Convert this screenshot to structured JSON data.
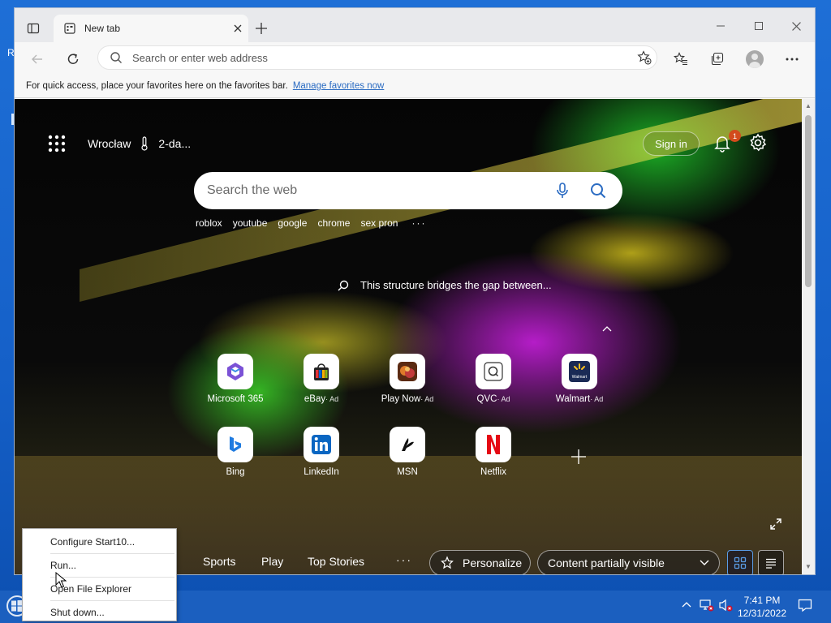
{
  "desktop": {
    "letter": "R"
  },
  "browser": {
    "tab_title": "New tab",
    "address_placeholder": "Search or enter web address",
    "favbar_text": "For quick access, place your favorites here on the favorites bar.",
    "favbar_link": "Manage favorites now"
  },
  "page": {
    "location": "Wrocław",
    "weather_text": "2-da...",
    "sign_in": "Sign in",
    "notification_count": "1",
    "search_placeholder": "Search the web",
    "trending": [
      "roblox",
      "youtube",
      "google",
      "chrome",
      "sex pron"
    ],
    "trending_more": "···",
    "caption": "This structure bridges the gap between...",
    "tiles": [
      {
        "label": "Microsoft 365",
        "ad": "",
        "icon": "microsoft365-icon"
      },
      {
        "label": "eBay",
        "ad": "· Ad",
        "icon": "ebay-icon"
      },
      {
        "label": "Play Now",
        "ad": "· Ad",
        "icon": "playnow-icon"
      },
      {
        "label": "QVC",
        "ad": "· Ad",
        "icon": "qvc-icon"
      },
      {
        "label": "Walmart",
        "ad": "· Ad",
        "icon": "walmart-icon"
      },
      {
        "label": "Bing",
        "ad": "",
        "icon": "bing-icon"
      },
      {
        "label": "LinkedIn",
        "ad": "",
        "icon": "linkedin-icon"
      },
      {
        "label": "MSN",
        "ad": "",
        "icon": "msn-icon"
      },
      {
        "label": "Netflix",
        "ad": "",
        "icon": "netflix-icon"
      }
    ],
    "feed_links": [
      "Sports",
      "Play",
      "Top Stories"
    ],
    "feed_more": "···",
    "personalize": "Personalize",
    "content_visibility": "Content partially visible"
  },
  "taskbar": {
    "time": "7:41 PM",
    "date": "12/31/2022"
  },
  "context_menu": {
    "items": [
      "Configure Start10...",
      "Run...",
      "Open File Explorer",
      "Shut down..."
    ]
  },
  "colors": {
    "accent": "#2a6bc2",
    "taskbar": "#1b5fbf",
    "notification_badge": "#d24b1c"
  }
}
